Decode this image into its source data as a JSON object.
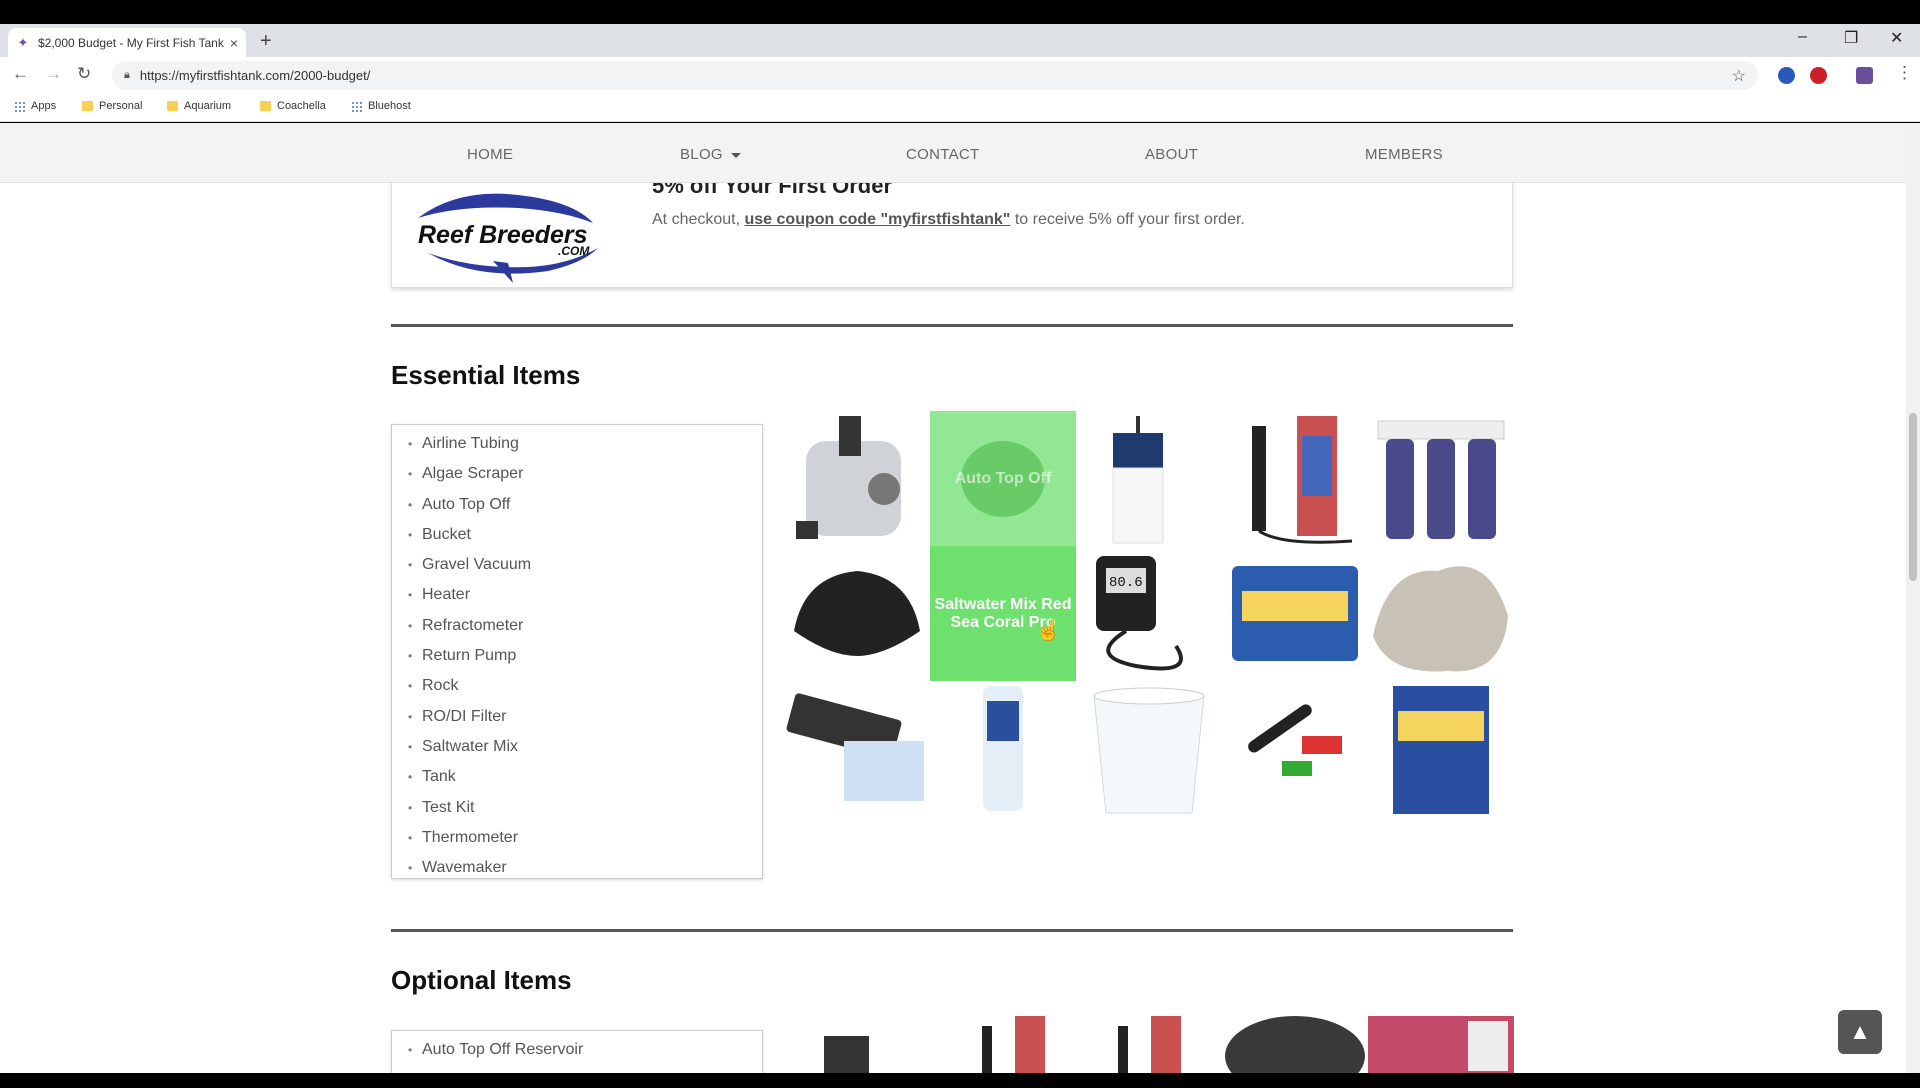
{
  "browser": {
    "tab_title": "$2,000 Budget - My First Fish Tank",
    "tab_close": "×",
    "new_tab": "+",
    "url": "https://myfirstfishtank.com/2000-budget/",
    "window_controls": [
      "–",
      "❐",
      "✕"
    ],
    "bookmarks": [
      "Apps",
      "Personal",
      "Aquarium",
      "Coachella",
      "Bluehost"
    ]
  },
  "nav": {
    "items": [
      "HOME",
      "BLOG",
      "CONTACT",
      "ABOUT",
      "MEMBERS"
    ]
  },
  "promo": {
    "heading": "5% off Your First Order",
    "text_before": "At checkout, ",
    "link": "use coupon code \"myfirstfishtank\"",
    "text_after": " to receive 5% off your first order.",
    "logo_main": "Reef Breeders",
    "logo_sub": ".COM"
  },
  "essential": {
    "title": "Essential Items",
    "items": [
      "Airline Tubing",
      "Algae Scraper",
      "Auto Top Off",
      "Bucket",
      "Gravel Vacuum",
      "Heater",
      "Refractometer",
      "Return Pump",
      "Rock",
      "RO/DI Filter",
      "Saltwater Mix",
      "Tank",
      "Test Kit",
      "Thermometer",
      "Wavemaker"
    ],
    "hover_label_fading": "Auto Top Off",
    "hover_label_active": "Saltwater Mix Red Sea Coral Pro",
    "thermometer_reading": "80.6"
  },
  "optional": {
    "title": "Optional Items",
    "items": [
      "Auto Top Off Reservoir"
    ]
  },
  "colors": {
    "hover_overlay": "#6ee06e",
    "accent_dark": "#555555"
  },
  "icons": [
    "back-arrow-icon",
    "forward-arrow-icon",
    "reload-icon",
    "lock-icon",
    "star-icon",
    "chevron-up-icon"
  ]
}
